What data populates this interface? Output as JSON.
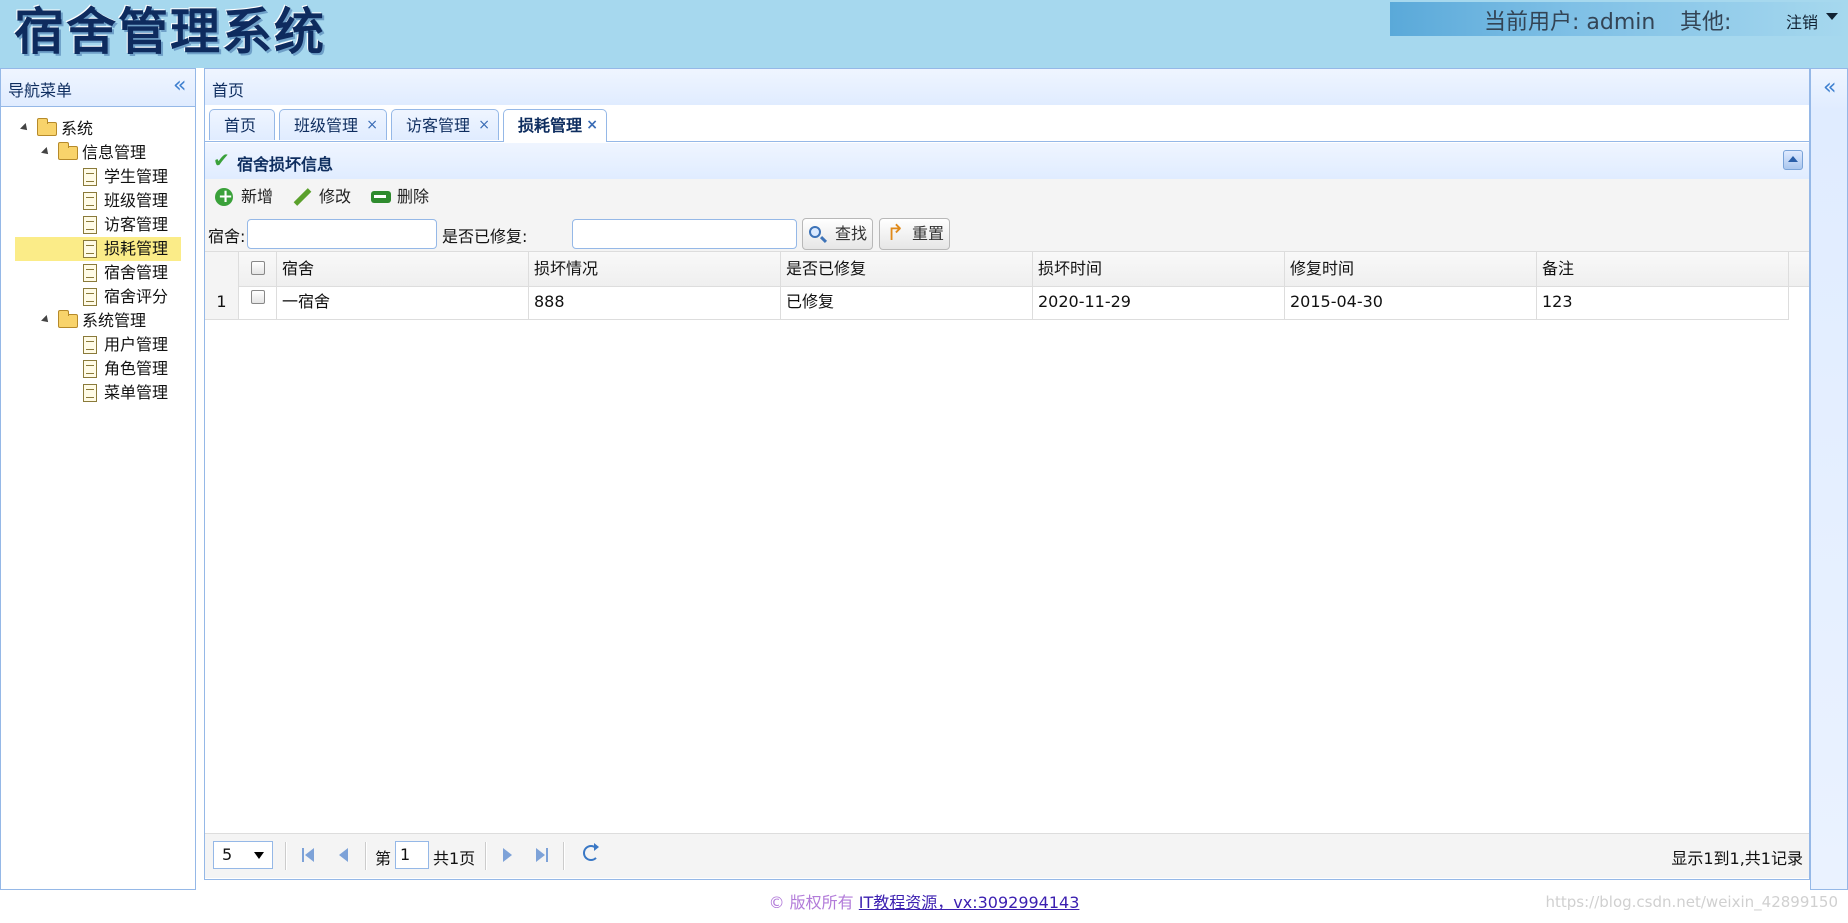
{
  "header": {
    "logo": "宿舍管理系统",
    "current_user": "当前用户: admin",
    "other": "其他:",
    "logout": "注销"
  },
  "nav": {
    "title": "导航菜单",
    "tree": {
      "root": "系统",
      "info_group": "信息管理",
      "info_items": [
        "学生管理",
        "班级管理",
        "访客管理",
        "损耗管理",
        "宿舍管理",
        "宿舍评分"
      ],
      "sys_group": "系统管理",
      "sys_items": [
        "用户管理",
        "角色管理",
        "菜单管理"
      ]
    }
  },
  "center": {
    "title": "首页",
    "tabs": [
      {
        "label": "首页",
        "closable": false
      },
      {
        "label": "班级管理",
        "closable": true
      },
      {
        "label": "访客管理",
        "closable": true
      },
      {
        "label": "损耗管理",
        "closable": true,
        "active": true
      }
    ],
    "tab_close": "×"
  },
  "panel": {
    "title": "宿舍损坏信息",
    "toolbar": {
      "add": "新增",
      "edit": "修改",
      "delete": "删除"
    },
    "search": {
      "dorm_label": "宿舍:",
      "dorm_value": "",
      "repaired_label": "是否已修复:",
      "repaired_value": "",
      "find": "查找",
      "reset": "重置"
    }
  },
  "grid": {
    "columns": [
      "宿舍",
      "损坏情况",
      "是否已修复",
      "损坏时间",
      "修复时间",
      "备注"
    ],
    "rows": [
      {
        "num": "1",
        "cells": [
          "一宿舍",
          "888",
          "已修复",
          "2020-11-29",
          "2015-04-30",
          "123"
        ]
      }
    ]
  },
  "pager": {
    "page_size": "5",
    "page_prefix": "第",
    "page_value": "1",
    "page_total": "共1页",
    "info": "显示1到1,共1记录"
  },
  "footer": {
    "copyright": "© 版权所有",
    "link": "IT教程资源，vx:3092994143",
    "watermark": "https://blog.csdn.net/weixin_42899150"
  },
  "colors": {
    "header_bg": "#a6d8ee",
    "panel_border": "#95b8e7",
    "selected_node": "#fbec88",
    "accent": "#3d7fcf"
  },
  "icons": {
    "collapse_west": "double-chevron-left-icon",
    "collapse_east": "double-chevron-left-icon",
    "panel_title": "checkmark-icon",
    "add": "plus-icon",
    "edit": "pencil-icon",
    "delete": "minus-icon",
    "find": "magnifier-icon",
    "reset": "redo-arrow-icon",
    "refresh": "refresh-icon"
  }
}
